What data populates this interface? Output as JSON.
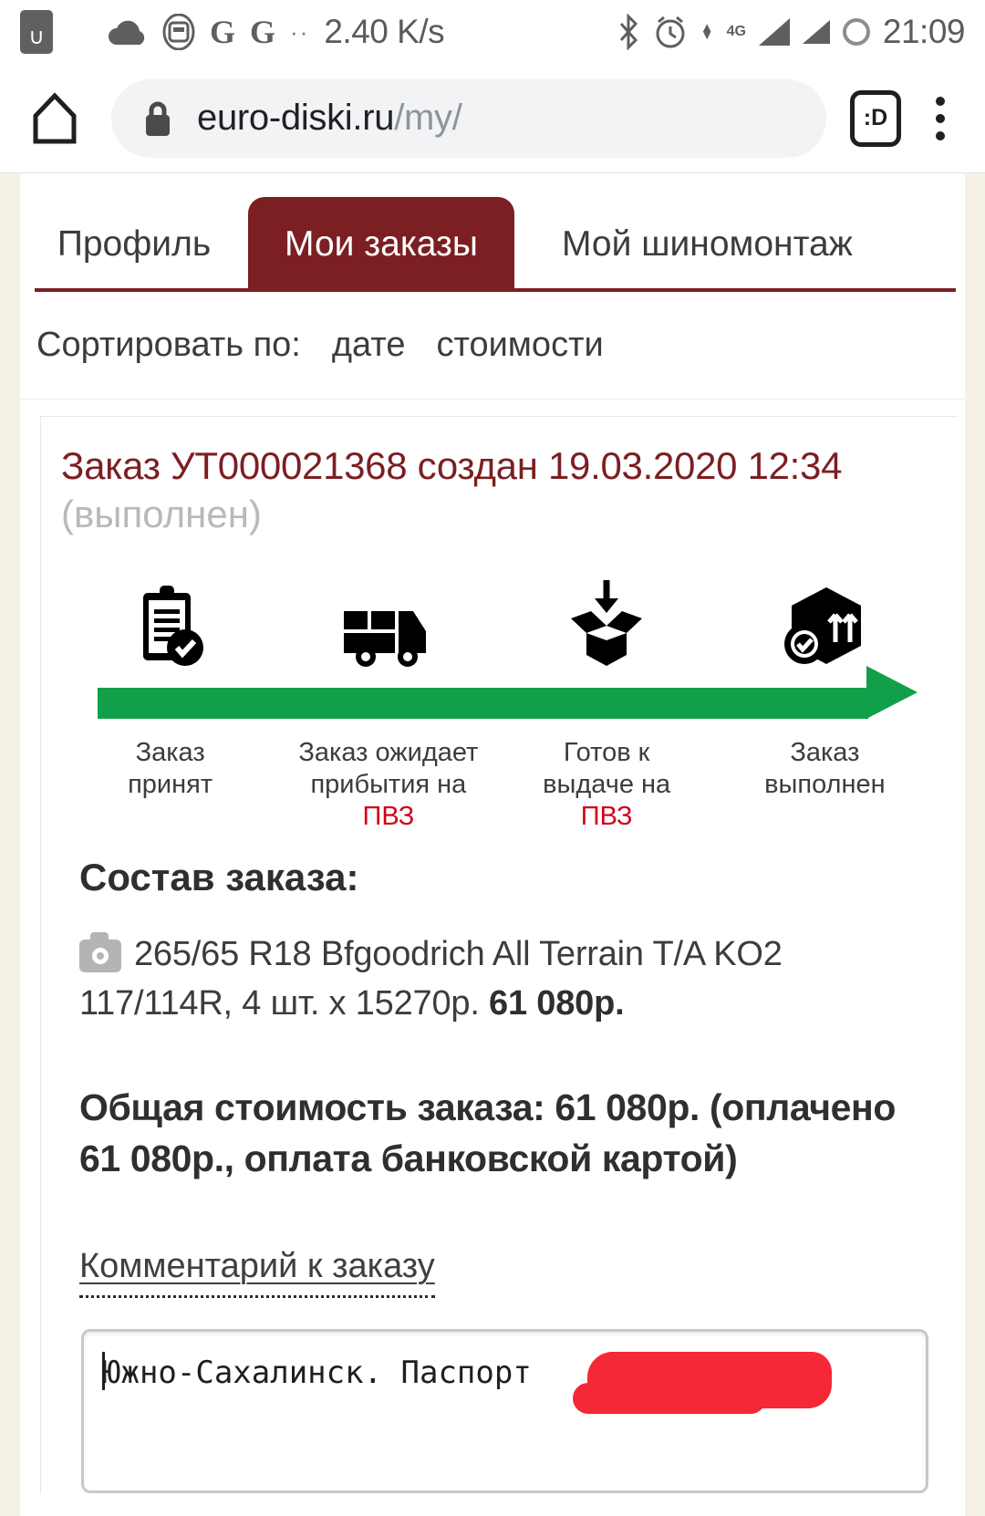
{
  "statusbar": {
    "sim_glyph": "∪",
    "cloud_icon": "cloud-icon",
    "sim_card_icon": "sim-card-icon",
    "google_icon_1": "G",
    "google_icon_2": "G",
    "dots_icon": "··",
    "network_speed": "2.40 K/s",
    "bluetooth_icon": "bluetooth-icon",
    "alarm_icon": "alarm-clock-icon",
    "network_type": "4G",
    "signal_icon": "signal-bars-icon",
    "battery_icon": "battery-ring-icon",
    "clock": "21:09"
  },
  "browser": {
    "home_icon": "home-icon",
    "lock_icon": "lock-icon",
    "url_domain": "euro-diski.ru",
    "url_path": "/my/",
    "tab_count_label": ":D",
    "menu_icon": "kebab-menu-icon"
  },
  "tabs": [
    {
      "label": "Профиль",
      "active": false
    },
    {
      "label": "Мои заказы",
      "active": true
    },
    {
      "label": "Мой шиномонтаж",
      "active": false
    }
  ],
  "sort": {
    "label": "Сортировать по:",
    "options": [
      "дате",
      "стоимости"
    ]
  },
  "order": {
    "title": "Заказ УТ000021368 создан 19.03.2020 12:34",
    "status": "(выполнен)",
    "steps": [
      {
        "icon": "clipboard-check-icon",
        "line1": "Заказ",
        "line2": "принят",
        "line3": ""
      },
      {
        "icon": "delivery-truck-icon",
        "line1": "Заказ ожидает",
        "line2": "прибытия на",
        "line3": "ПВЗ"
      },
      {
        "icon": "open-box-icon",
        "line1": "Готов к",
        "line2": "выдаче на",
        "line3": "ПВЗ"
      },
      {
        "icon": "package-check-icon",
        "line1": "Заказ",
        "line2": "выполнен",
        "line3": ""
      }
    ],
    "progress_color": "#11a049",
    "contents_title": "Состав заказа:",
    "item": {
      "photo_icon": "camera-icon",
      "name": "265/65 R18 Bfgoodrich All Terrain T/A KO2",
      "spec": "117/114R, 4 шт. x 15270р.",
      "line_total": "61 080р."
    },
    "total_text": "Общая стоимость заказа: 61 080р. (оплачено 61 080р., оплата банковской картой)",
    "comment_label": "Комментарий к заказу",
    "comment_value": "Южно-Сахалинск. Паспорт ",
    "comment_placeholder": "Комментарий к заказу"
  }
}
